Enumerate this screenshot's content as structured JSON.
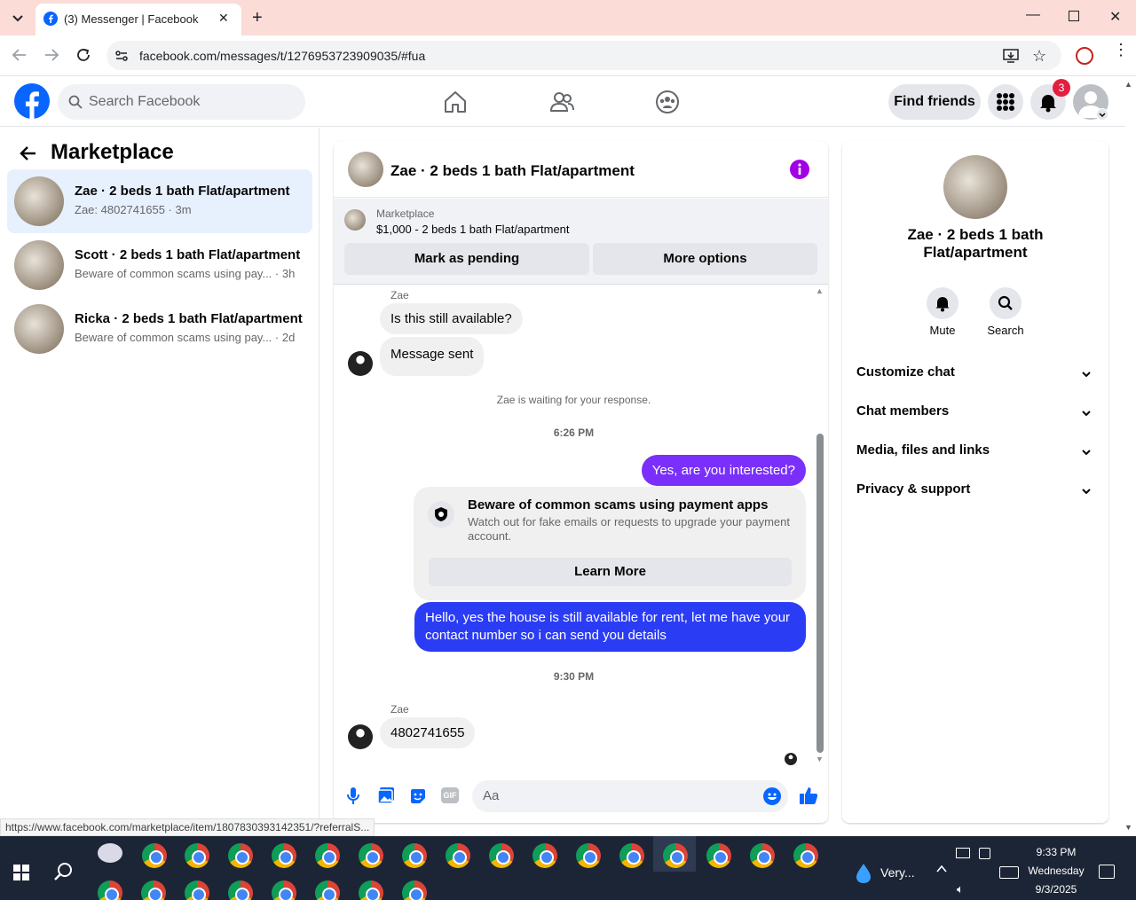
{
  "browser": {
    "tab_title": "(3) Messenger | Facebook",
    "url": "facebook.com/messages/t/1276953723909035/#fua",
    "status_url": "https://www.facebook.com/marketplace/item/1807830393142351/?referralS..."
  },
  "fb_nav": {
    "search_placeholder": "Search Facebook",
    "find_friends_label": "Find friends",
    "notification_count": "3"
  },
  "left": {
    "title": "Marketplace",
    "conversations": [
      {
        "name": "Zae · 2 beds 1 bath Flat/apartment",
        "preview": "Zae: 4802741655 · 3m"
      },
      {
        "name": "Scott · 2 beds 1 bath Flat/apartment",
        "preview": "Beware of common scams using pay... · 3h"
      },
      {
        "name": "Ricka · 2 beds 1 bath Flat/apartment",
        "preview": "Beware of common scams using pay... · 2d"
      }
    ]
  },
  "chat": {
    "title": "Zae · 2 beds 1 bath Flat/apartment",
    "marketplace_label": "Marketplace",
    "listing": "$1,000 - 2 beds 1 bath Flat/apartment",
    "mark_pending": "Mark as pending",
    "more_options": "More options",
    "sender1": "Zae",
    "msg1": "Is this still available?",
    "msg2": "Message sent",
    "waiting": "Zae is waiting for your response.",
    "time1": "6:26 PM",
    "out1": "Yes, are you interested?",
    "scam_title": "Beware of common scams using payment apps",
    "scam_body": "Watch out for fake emails or requests to upgrade your payment account.",
    "learn_more": "Learn More",
    "out2": "Hello, yes the house is still available for rent, let me have your contact number so i can send you details",
    "time2": "9:30 PM",
    "sender2": "Zae",
    "msg3": "4802741655",
    "composer_placeholder": "Aa"
  },
  "right": {
    "title": "Zae · 2 beds 1 bath Flat/apartment",
    "mute": "Mute",
    "search": "Search",
    "rows": [
      "Customize chat",
      "Chat members",
      "Media, files and links",
      "Privacy & support"
    ]
  },
  "taskbar": {
    "weather": "Very...",
    "time": "9:33 PM",
    "day": "Wednesday",
    "date": "9/3/2025"
  },
  "colors": {
    "accent_purple": "#7a2ffb",
    "accent_blue": "#2b3cf5",
    "fb_blue": "#0866ff"
  }
}
